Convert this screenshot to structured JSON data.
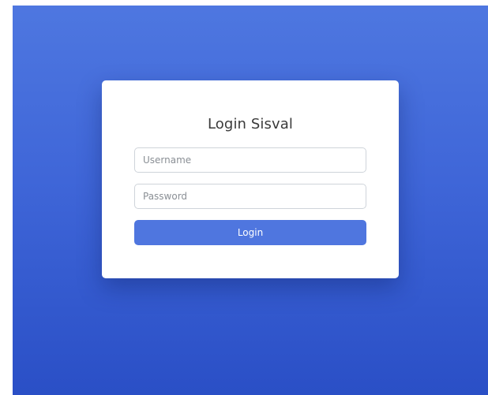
{
  "login": {
    "title": "Login Sisval",
    "username": {
      "value": "",
      "placeholder": "Username"
    },
    "password": {
      "value": "",
      "placeholder": "Password"
    },
    "submit_label": "Login"
  },
  "colors": {
    "background_top": "#4e77e0",
    "background_bottom": "#2a4fc6",
    "card": "#ffffff",
    "button": "#4f76df",
    "button_text": "#ffffff",
    "title_text": "#3a3a3a"
  }
}
